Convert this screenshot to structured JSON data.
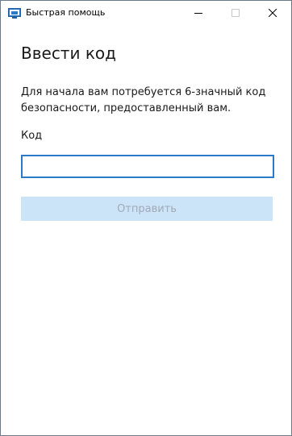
{
  "window": {
    "title": "Быстрая помощь",
    "app_icon": "quick-assist-icon",
    "controls": {
      "minimize_icon": "minimize-icon",
      "maximize_icon": "maximize-icon",
      "close_icon": "close-icon"
    }
  },
  "main": {
    "heading": "Ввести код",
    "description": "Для начала вам потребуется 6-значный код безопасности, предоставленный вам.",
    "code_label": "Код",
    "code_value": "",
    "submit_label": "Отправить",
    "submit_enabled": false
  },
  "colors": {
    "accent": "#2b79c7",
    "button_disabled_bg": "#cce4f7",
    "button_disabled_text": "#a0aab8"
  }
}
